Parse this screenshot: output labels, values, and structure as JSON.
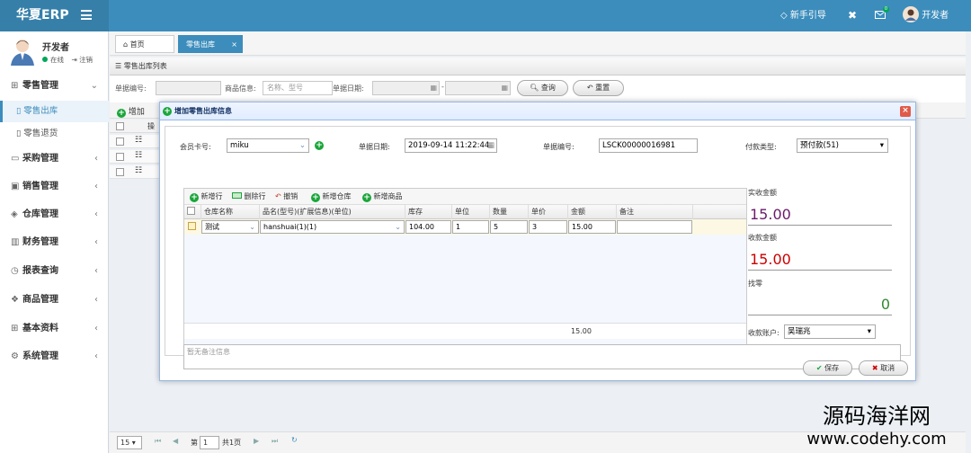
{
  "app": {
    "title": "华夏ERP"
  },
  "topbar": {
    "guide": "新手引导",
    "user": "开发者"
  },
  "user": {
    "name": "开发者",
    "status": "在线",
    "logout": "注销"
  },
  "sidebar": {
    "sections": [
      {
        "label": "零售管理",
        "icon": "gift-icon",
        "expanded": true,
        "children": [
          "零售出库",
          "零售退货"
        ]
      },
      {
        "label": "采购管理",
        "icon": "monitor-icon"
      },
      {
        "label": "销售管理",
        "icon": "calendar-icon"
      },
      {
        "label": "仓库管理",
        "icon": "layers-icon"
      },
      {
        "label": "财务管理",
        "icon": "book-icon"
      },
      {
        "label": "报表查询",
        "icon": "clock-icon"
      },
      {
        "label": "商品管理",
        "icon": "cubes-icon"
      },
      {
        "label": "基本资料",
        "icon": "grid-icon"
      },
      {
        "label": "系统管理",
        "icon": "gear-icon"
      }
    ]
  },
  "tabs": [
    {
      "label": "首页"
    },
    {
      "label": "零售出库"
    }
  ],
  "list": {
    "title": "零售出库列表",
    "search": {
      "bill_no_label": "单据编号:",
      "goods_label": "商品信息:",
      "goods_placeholder": "名称、型号",
      "date_label": "单据日期:",
      "query_btn": "查询",
      "reset_btn": "重置"
    },
    "toolbar": {
      "add": "增加"
    },
    "col_op": "操"
  },
  "pager": {
    "page_size": "15",
    "page_prefix": "第",
    "page_no": "1",
    "total": "共1页"
  },
  "dialog": {
    "title": "增加零售出库信息",
    "member_label": "会员卡号:",
    "member_value": "miku",
    "date_label": "单据日期:",
    "date_value": "2019-09-14 11:22:44",
    "bill_label": "单据编号:",
    "bill_value": "LSCK00000016981",
    "paytype_label": "付款类型:",
    "paytype_value": "预付款(51)",
    "grid_toolbar": {
      "add_row": "新增行",
      "del_row": "删除行",
      "undo": "撤销",
      "add_depot": "新增仓库",
      "add_goods": "新增商品"
    },
    "grid_cols": [
      "仓库名称",
      "品名(型号)(扩展信息)(单位)",
      "库存",
      "单位",
      "数量",
      "单价",
      "金额",
      "备注"
    ],
    "grid_rows": [
      {
        "depot": "测试",
        "goods": "hanshuai(1)(1)",
        "stock": "104.00",
        "unit": "1",
        "qty": "5",
        "price": "3",
        "amount": "15.00",
        "remark": ""
      }
    ],
    "footer_total": "15.00",
    "right": {
      "actual_label": "实收金额",
      "actual_value": "15.00",
      "collect_label": "收款金额",
      "collect_value": "15.00",
      "change_label": "找零",
      "change_value": "0",
      "account_label": "收款账户:",
      "account_value": "吴瑞兆"
    },
    "remark_placeholder": "暂无备注信息",
    "save_btn": "保存",
    "cancel_btn": "取消"
  },
  "watermark": {
    "line1": "源码海洋网",
    "line2": "www.codehy.com"
  },
  "colors": {
    "brand": "#3c8dbc",
    "green": "#19a63a",
    "red": "#cc0000",
    "purple": "#6a1b6a"
  }
}
